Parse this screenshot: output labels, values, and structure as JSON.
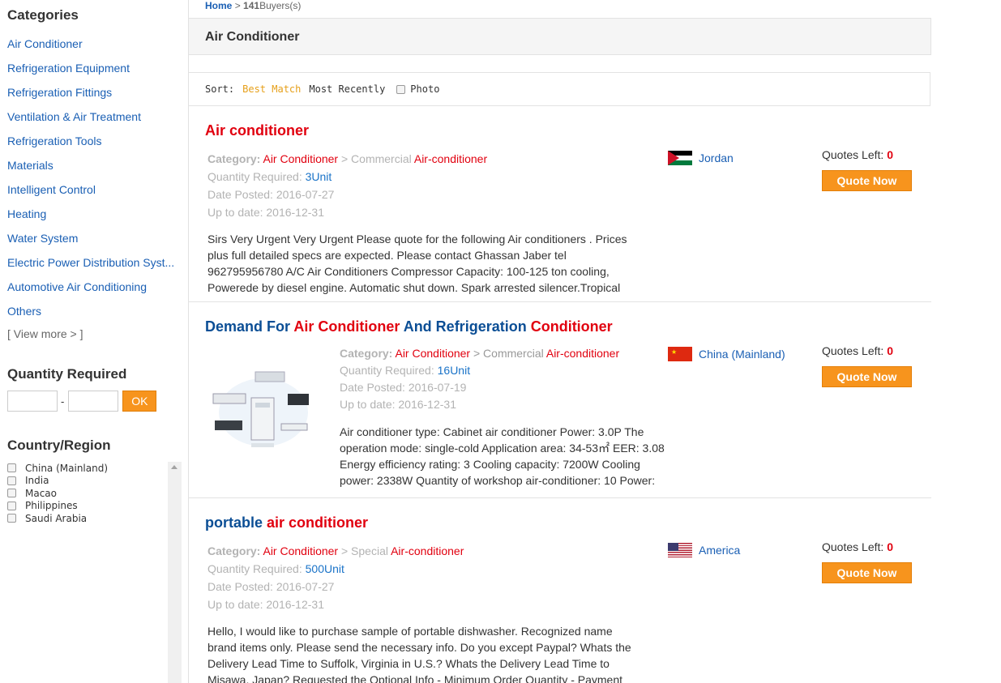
{
  "sidebar": {
    "categories_title": "Categories",
    "categories": [
      "Air Conditioner",
      "Refrigeration Equipment",
      "Refrigeration Fittings",
      "Ventilation & Air Treatment",
      "Refrigeration Tools",
      "Materials",
      "Intelligent Control",
      "Heating",
      "Water System",
      "Electric Power Distribution Syst...",
      "Automotive Air Conditioning",
      "Others"
    ],
    "view_more": "[ View more > ]",
    "quantity_title": "Quantity Required",
    "quantity_dash": "-",
    "ok_label": "OK",
    "country_title": "Country/Region",
    "countries": [
      "China (Mainland)",
      "India",
      "Macao",
      "Philippines",
      "Saudi Arabia"
    ]
  },
  "breadcrumb": {
    "home": "Home",
    "sep": ">",
    "count": "141",
    "suffix": "Buyers(s)"
  },
  "page_title": "Air Conditioner",
  "sort": {
    "label": "Sort:",
    "best_match": "Best Match",
    "most_recently": "Most Recently",
    "photo": "Photo"
  },
  "listings": [
    {
      "title_parts": [
        {
          "text": "Air conditioner",
          "color": "red"
        }
      ],
      "category_label": "Category:",
      "category": "Air Conditioner",
      "sub_prefix": "> Commercial",
      "sub_hl": "Air-conditioner",
      "qty_label": "Quantity Required:",
      "qty": "3Unit",
      "date_posted": "Date Posted: 2016-07-27",
      "up_to_date": "Up to date: 2016-12-31",
      "description": "Sirs Very Urgent Very Urgent Please quote for the following Air conditioners . Prices plus full detailed specs are expected. Please contact Ghassan Jaber tel 962795956780 A/C Air Conditioners Compressor Capacity: 100-125 ton cooling, Poweredе by diesel engine. Automatic shut down. Spark arrested silencer.Tropical",
      "country": "Jordan",
      "quotes_label": "Quotes Left:",
      "quotes_left": "0",
      "quote_btn": "Quote Now"
    },
    {
      "title_parts": [
        {
          "text": "Demand For ",
          "color": "blue"
        },
        {
          "text": "Air Conditioner",
          "color": "red"
        },
        {
          "text": " And Refrigeration ",
          "color": "blue"
        },
        {
          "text": "Conditioner",
          "color": "red"
        }
      ],
      "category_label": "Category:",
      "category": "Air Conditioner",
      "sub_prefix": "> Commercial",
      "sub_hl": "Air-conditioner",
      "qty_label": "Quantity Required:",
      "qty": "16Unit",
      "date_posted": "Date Posted: 2016-07-19",
      "up_to_date": "Up to date: 2016-12-31",
      "description": "Air conditioner type: Cabinet air conditioner Power: 3.0P The operation mode: single-cold Application area: 34-53㎡ EER: 3.08 Energy efficiency rating: 3 Cooling capacity: 7200W Cooling power: 2338W Quantity of workshop air-conditioner: 10 Power:",
      "country": "China (Mainland)",
      "quotes_label": "Quotes Left:",
      "quotes_left": "0",
      "quote_btn": "Quote Now"
    },
    {
      "title_parts": [
        {
          "text": "portable ",
          "color": "blue"
        },
        {
          "text": "air conditioner",
          "color": "red"
        }
      ],
      "category_label": "Category:",
      "category": "Air Conditioner",
      "sub_prefix": "> Special",
      "sub_hl": "Air-conditioner",
      "qty_label": "Quantity Required:",
      "qty": "500Unit",
      "date_posted": "Date Posted: 2016-07-27",
      "up_to_date": "Up to date: 2016-12-31",
      "description": "Hello, I would like to purchase sample of portable dishwasher. Recognized name brand items only. Please send the necessary info. Do you except Paypal? Whats the Delivery Lead Time to Suffolk, Virginia in U.S.? Whats the Delivery Lead Time to Misawa, Japan? Requested the Optional Info - Minimum Order Quantity - Payment",
      "country": "America",
      "quotes_label": "Quotes Left:",
      "quotes_left": "0",
      "quote_btn": "Quote Now"
    }
  ]
}
